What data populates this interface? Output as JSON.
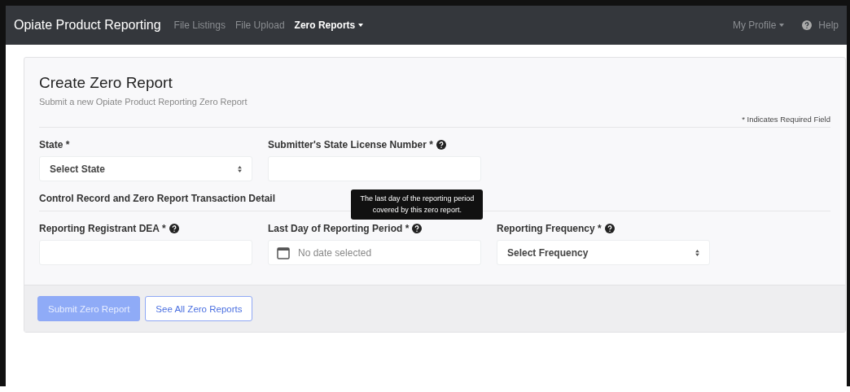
{
  "navbar": {
    "brand": "Opiate Product Reporting",
    "links": [
      {
        "label": "File Listings",
        "selected": false,
        "dropdown": false
      },
      {
        "label": "File Upload",
        "selected": false,
        "dropdown": false
      },
      {
        "label": "Zero Reports",
        "selected": true,
        "dropdown": true
      }
    ],
    "right_links": [
      {
        "label": "My Profile",
        "kind": "dropdown"
      },
      {
        "label": "Help",
        "kind": "help"
      }
    ]
  },
  "form": {
    "title": "Create Zero Report",
    "subtitle": "Submit a new Opiate Product Reporting Zero Report",
    "required_note": "* Indicates Required Field",
    "rows": [
      {
        "fields": [
          {
            "label": "State *",
            "kind": "select",
            "help": false,
            "placeholder": "Select State"
          },
          {
            "label": "Submitter's State License Number *",
            "kind": "text",
            "help": true
          }
        ]
      },
      {
        "heading": "Control Record and Zero Report Transaction Detail",
        "fields": [
          {
            "label": "Reporting Registrant DEA *",
            "kind": "text",
            "help": true
          },
          {
            "label": "Last Day of Reporting Period *",
            "kind": "date",
            "help": true,
            "placeholder": "No date selected",
            "tooltip": "The last day of the reporting period covered by this zero report."
          },
          {
            "label": "Reporting Frequency *",
            "kind": "select",
            "help": true,
            "placeholder": "Select Frequency"
          }
        ]
      }
    ]
  },
  "buttons": [
    {
      "label": "Submit Zero Report",
      "kind": "primary",
      "disabled": true
    },
    {
      "label": "See All Zero Reports",
      "kind": "outline",
      "disabled": false
    }
  ]
}
